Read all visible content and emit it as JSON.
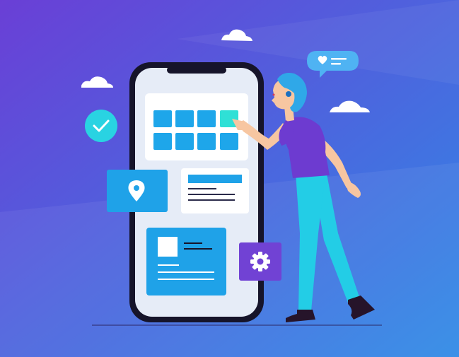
{
  "colors": {
    "bg_top": "#6a3fd6",
    "bg_bottom": "#2f8ae6",
    "phone_frame": "#16142a",
    "phone_screen": "#e6ecf7",
    "accent_blue": "#1fa2e8",
    "accent_cyan": "#29d3e2",
    "accent_purple": "#7142d4",
    "grid_tile": "#1ea6ea",
    "grid_tile_active": "#2fe0d6",
    "card_white": "#ffffff",
    "skin": "#f7c6a1",
    "hair": "#2fa8e8",
    "shirt": "#6d3bd0",
    "pants": "#23cde6",
    "shoes": "#26142a"
  },
  "illustration": {
    "scene": "woman-tapping-phone-app-grid",
    "icons": [
      "check-icon",
      "location-pin-icon",
      "gear-icon",
      "heart-icon"
    ]
  }
}
